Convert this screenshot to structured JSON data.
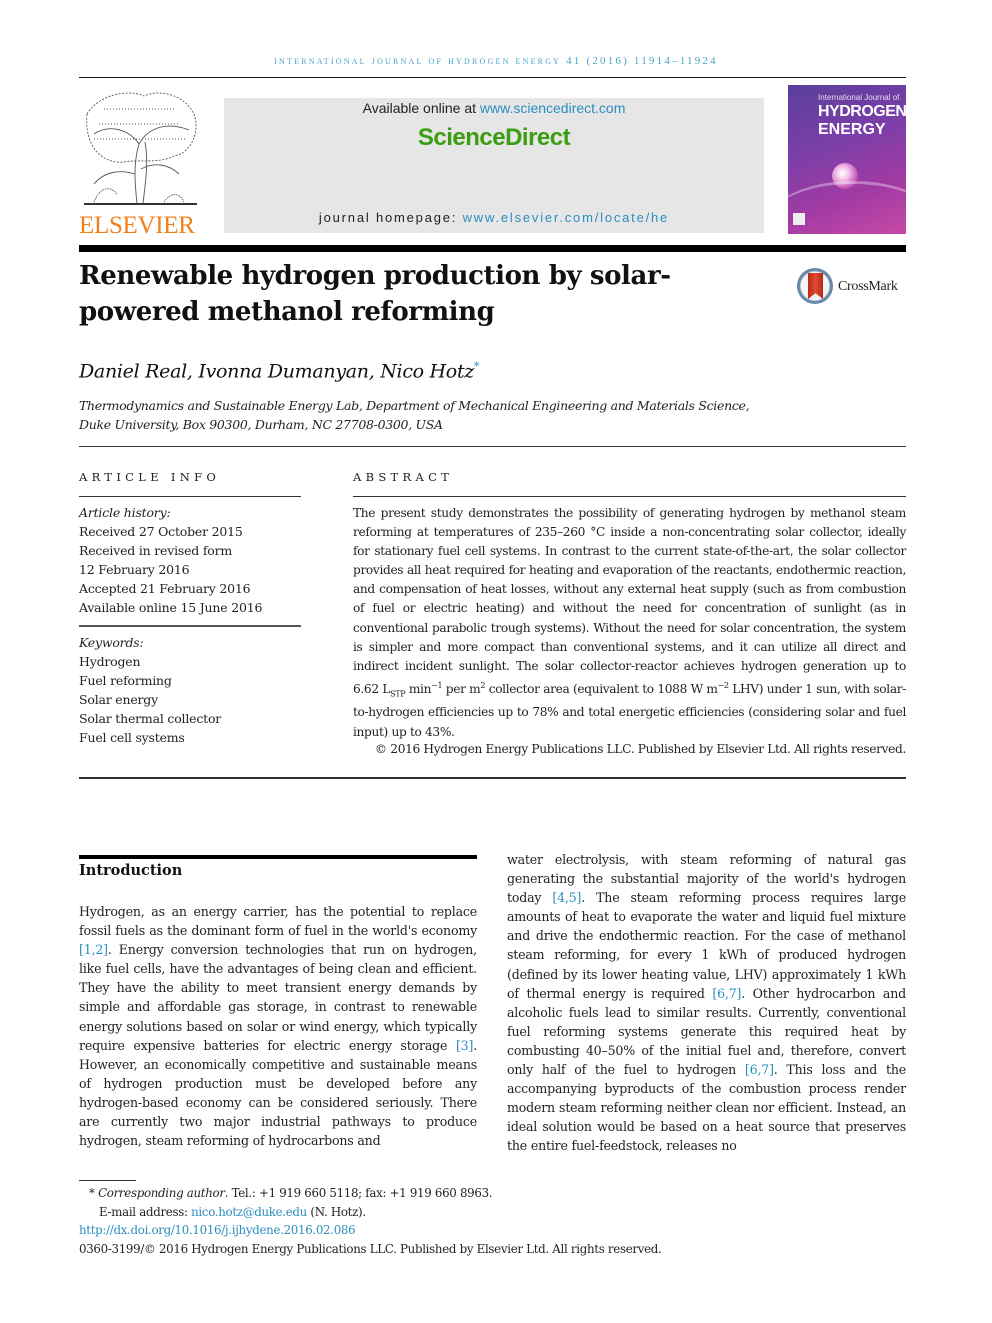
{
  "running_head": "International Journal of Hydrogen Energy 41 (2016) 11914–11924",
  "publisher": {
    "logo_word": "ELSEVIER",
    "available_prefix": "Available online at ",
    "available_link": "www.sciencedirect.com",
    "brand": "ScienceDirect",
    "homepage_prefix": "journal homepage: ",
    "homepage_link": "www.elsevier.com/locate/he",
    "brand_color": "#3a9d12",
    "link_color": "#2a8fbd",
    "logo_color": "#f07f1c"
  },
  "cover": {
    "line1": "International Journal of",
    "line2": "HYDROGEN",
    "line3": "ENERGY"
  },
  "article": {
    "title": "Renewable hydrogen production by solar-powered methanol reforming",
    "crossmark_label": "CrossMark",
    "authors": "Daniel Real, Ivonna Dumanyan, Nico Hotz",
    "corresponding_mark": "*",
    "affiliation": "Thermodynamics and Sustainable Energy Lab, Department of Mechanical Engineering and Materials Science, Duke University, Box 90300, Durham, NC 27708-0300, USA"
  },
  "article_info": {
    "heading": "ARTICLE INFO",
    "history_label": "Article history:",
    "history": [
      "Received 27 October 2015",
      "Received in revised form",
      "12 February 2016",
      "Accepted 21 February 2016",
      "Available online 15 June 2016"
    ],
    "keywords_label": "Keywords:",
    "keywords": [
      "Hydrogen",
      "Fuel reforming",
      "Solar energy",
      "Solar thermal collector",
      "Fuel cell systems"
    ]
  },
  "abstract": {
    "heading": "ABSTRACT",
    "text_1": "The present study demonstrates the possibility of generating hydrogen by methanol steam reforming at temperatures of 235–260 °C inside a non-concentrating solar collector, ideally for stationary fuel cell systems. In contrast to the current state-of-the-art, the solar collector provides all heat required for heating and evaporation of the reactants, endothermic reaction, and compensation of heat losses, without any external heat supply (such as from combustion of fuel or electric heating) and without the need for concentration of sunlight (as in conventional parabolic trough systems). Without the need for solar concentration, the system is simpler and more compact than conventional systems, and it can utilize all direct and indirect incident sunlight. The solar collector-reactor achieves hydrogen generation up to 6.62 L",
    "sub_stp": "STP",
    "text_2": " min",
    "sup_1": "−1",
    "text_3": " per m",
    "sup_2": "2",
    "text_4": " collector area (equivalent to 1088 W m",
    "sup_3": "−2",
    "text_5": " LHV) under 1 sun, with solar-to-hydrogen efficiencies up to 78% and total energetic efficiencies (considering solar and fuel input) up to 43%.",
    "copyright": "© 2016 Hydrogen Energy Publications LLC. Published by Elsevier Ltd. All rights reserved."
  },
  "introduction": {
    "heading": "Introduction",
    "left": {
      "p1": "Hydrogen, as an energy carrier, has the potential to replace fossil fuels as the dominant form of fuel in the world's economy ",
      "ref1": "[1,2]",
      "p2": ". Energy conversion technologies that run on hydrogen, like fuel cells, have the advantages of being clean and efficient. They have the ability to meet transient energy demands by simple and affordable gas storage, in contrast to renewable energy solutions based on solar or wind energy, which typically require expensive batteries for electric energy storage ",
      "ref2": "[3]",
      "p3": ". However, an economically competitive and sustainable means of hydrogen production must be developed before any hydrogen-based economy can be considered seriously. There are currently two major industrial pathways to produce hydrogen, steam reforming of hydrocarbons and"
    },
    "right": {
      "p1": "water electrolysis, with steam reforming of natural gas generating the substantial majority of the world's hydrogen today ",
      "ref1": "[4,5]",
      "p2": ". The steam reforming process requires large amounts of heat to evaporate the water and liquid fuel mixture and drive the endothermic reaction. For the case of methanol steam reforming, for every 1 kWh of produced hydrogen (defined by its lower heating value, LHV) approximately 1 kWh of thermal energy is required ",
      "ref2": "[6,7]",
      "p3": ". Other hydrocarbon and alcoholic fuels lead to similar results. Currently, conventional fuel reforming systems generate this required heat by combusting 40–50% of the initial fuel and, therefore, convert only half of the fuel to hydrogen ",
      "ref3": "[6,7]",
      "p4": ". This loss and the accompanying byproducts of the combustion process render modern steam reforming neither clean nor efficient. Instead, an ideal solution would be based on a heat source that preserves the entire fuel-feedstock, releases no"
    }
  },
  "footnotes": {
    "mark": "* ",
    "corr_label": "Corresponding author",
    "corr_rest": ". Tel.: +1 919 660 5118; fax: +1 919 660 8963.",
    "email_prefix": "E-mail address: ",
    "email": "nico.hotz@duke.edu",
    "email_suffix": " (N. Hotz).",
    "doi": "http://dx.doi.org/10.1016/j.ijhydene.2016.02.086",
    "issn_line": "0360-3199/© 2016 Hydrogen Energy Publications LLC. Published by Elsevier Ltd. All rights reserved."
  }
}
